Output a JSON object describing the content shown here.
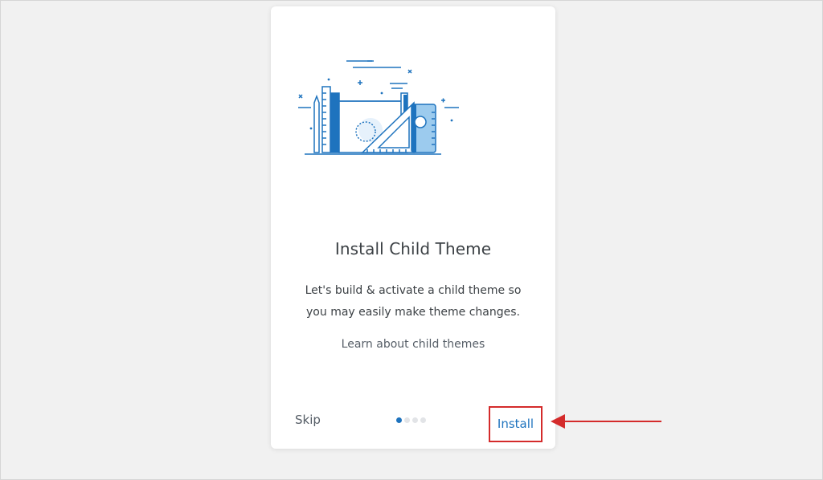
{
  "card": {
    "title": "Install Child Theme",
    "description": "Let's build & activate a child theme so you may easily make theme changes.",
    "learn_link": "Learn about child themes"
  },
  "footer": {
    "skip_label": "Skip",
    "install_label": "Install",
    "steps": {
      "current": 1,
      "total": 4
    }
  },
  "colors": {
    "accent": "#1e73be",
    "highlight": "#d42b2b",
    "illustration_light": "#9ccbee"
  }
}
